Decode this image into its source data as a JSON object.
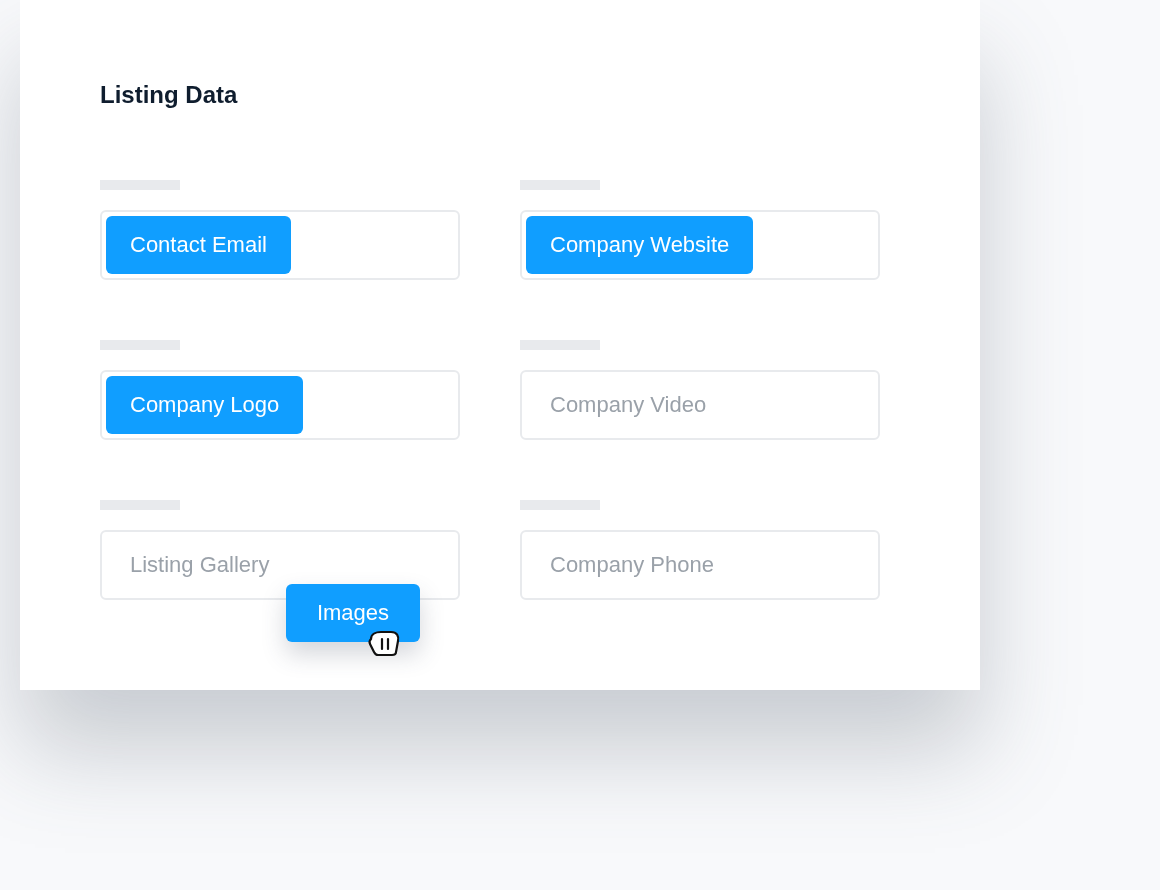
{
  "title": "Listing Data",
  "fields": [
    {
      "kind": "tag",
      "text": "Contact Email"
    },
    {
      "kind": "tag",
      "text": "Company Website"
    },
    {
      "kind": "tag",
      "text": "Company Logo"
    },
    {
      "kind": "placeholder",
      "text": "Company Video"
    },
    {
      "kind": "placeholder",
      "text": "Listing Gallery"
    },
    {
      "kind": "placeholder",
      "text": "Company Phone"
    }
  ],
  "dragged_tag": {
    "text": "Images"
  }
}
